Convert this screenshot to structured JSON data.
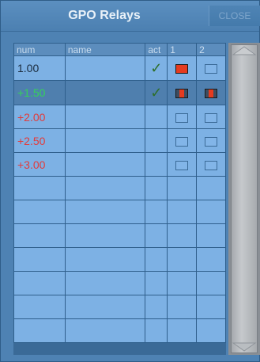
{
  "window": {
    "title": "GPO Relays",
    "close_label": "CLOSE"
  },
  "table": {
    "headers": [
      "num",
      "name",
      "act",
      "1",
      "2"
    ],
    "rows": [
      {
        "num": "1.00",
        "name": "",
        "act": true,
        "r1": "on",
        "r2": "off",
        "num_color": "normal",
        "selected": false
      },
      {
        "num": "+1.50",
        "name": "",
        "act": true,
        "r1": "half",
        "r2": "half",
        "num_color": "pos",
        "selected": true
      },
      {
        "num": "+2.00",
        "name": "",
        "act": false,
        "r1": "off",
        "r2": "off",
        "num_color": "neg",
        "selected": false
      },
      {
        "num": "+2.50",
        "name": "",
        "act": false,
        "r1": "off",
        "r2": "off",
        "num_color": "neg",
        "selected": false
      },
      {
        "num": "+3.00",
        "name": "",
        "act": false,
        "r1": "off",
        "r2": "off",
        "num_color": "neg",
        "selected": false
      },
      {
        "num": "",
        "name": "",
        "act": false,
        "r1": "none",
        "r2": "none",
        "num_color": "normal",
        "selected": false
      },
      {
        "num": "",
        "name": "",
        "act": false,
        "r1": "none",
        "r2": "none",
        "num_color": "normal",
        "selected": false
      },
      {
        "num": "",
        "name": "",
        "act": false,
        "r1": "none",
        "r2": "none",
        "num_color": "normal",
        "selected": false
      },
      {
        "num": "",
        "name": "",
        "act": false,
        "r1": "none",
        "r2": "none",
        "num_color": "normal",
        "selected": false
      },
      {
        "num": "",
        "name": "",
        "act": false,
        "r1": "none",
        "r2": "none",
        "num_color": "normal",
        "selected": false
      },
      {
        "num": "",
        "name": "",
        "act": false,
        "r1": "none",
        "r2": "none",
        "num_color": "normal",
        "selected": false
      },
      {
        "num": "",
        "name": "",
        "act": false,
        "r1": "none",
        "r2": "none",
        "num_color": "normal",
        "selected": false
      }
    ]
  },
  "colors": {
    "positive": "#35d15a",
    "negative": "#e23b3b",
    "relay_on": "#e53b1f",
    "check": "#2e6f2a"
  },
  "icons": {
    "check": "checkmark-icon",
    "scroll_up": "scroll-up-arrow-icon",
    "scroll_down": "scroll-down-arrow-icon"
  }
}
